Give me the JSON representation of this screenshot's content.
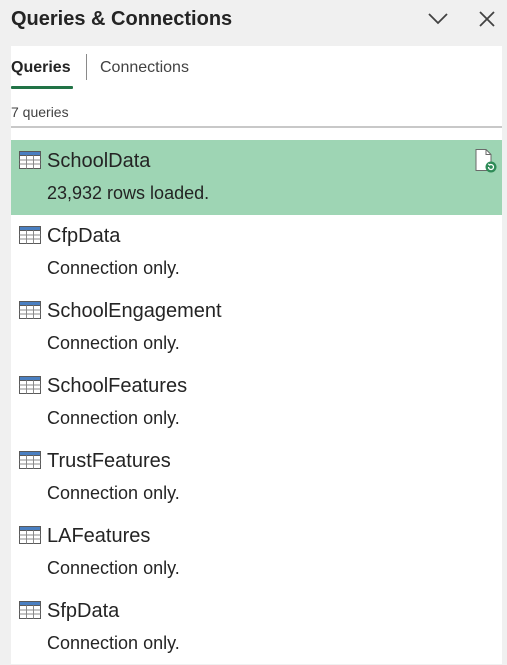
{
  "pane": {
    "title": "Queries & Connections"
  },
  "tabs": [
    {
      "label": "Queries",
      "active": true
    },
    {
      "label": "Connections",
      "active": false
    }
  ],
  "query_count": "7 queries",
  "queries": [
    {
      "name": "SchoolData",
      "status": "23,932 rows loaded.",
      "selected": true
    },
    {
      "name": "CfpData",
      "status": "Connection only.",
      "selected": false
    },
    {
      "name": "SchoolEngagement",
      "status": "Connection only.",
      "selected": false
    },
    {
      "name": "SchoolFeatures",
      "status": "Connection only.",
      "selected": false
    },
    {
      "name": "TrustFeatures",
      "status": "Connection only.",
      "selected": false
    },
    {
      "name": "LAFeatures",
      "status": "Connection only.",
      "selected": false
    },
    {
      "name": "SfpData",
      "status": "Connection only.",
      "selected": false
    }
  ],
  "colors": {
    "accent": "#217346",
    "selected_row": "#9ed5b4",
    "icon_blue": "#4a7fc1"
  },
  "icons": {
    "collapse": "chevron-down-icon",
    "close": "close-icon",
    "query": "table-icon",
    "refresh": "document-refresh-icon"
  }
}
